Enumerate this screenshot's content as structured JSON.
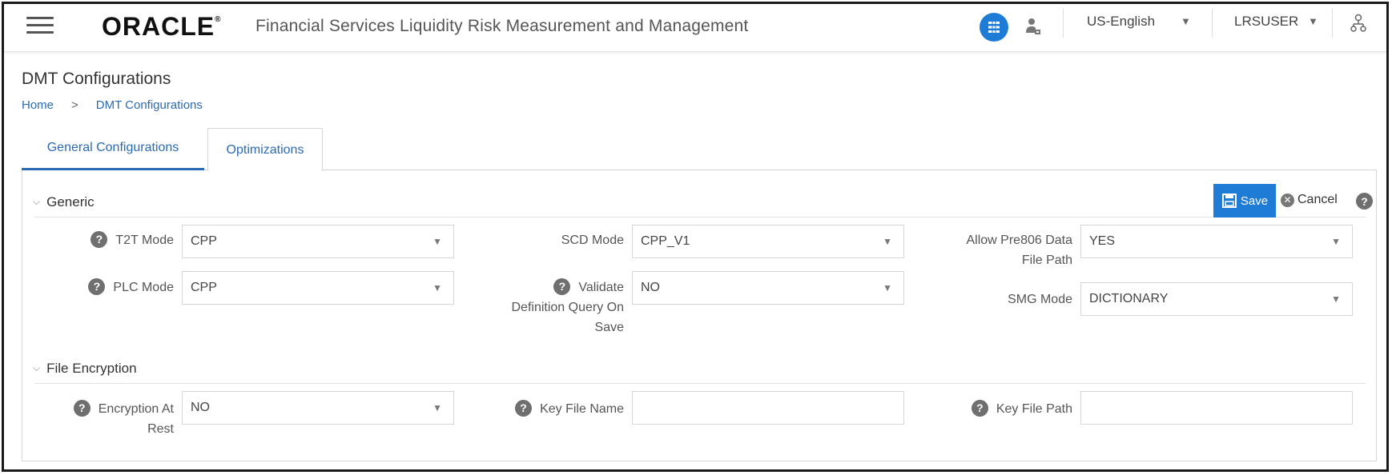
{
  "header": {
    "logo_text": "ORACLE",
    "app_title": "Financial Services Liquidity Risk Measurement and Management",
    "language": "US-English",
    "username": "LRSUSER"
  },
  "page": {
    "title": "DMT Configurations",
    "breadcrumb": {
      "home": "Home",
      "separator": ">",
      "current": "DMT Configurations"
    }
  },
  "tabs": [
    {
      "label": "General Configurations",
      "active": true
    },
    {
      "label": "Optimizations",
      "active": false
    }
  ],
  "actions": {
    "save_label": "Save",
    "cancel_label": "Cancel"
  },
  "sections": {
    "generic": {
      "title": "Generic",
      "fields": {
        "t2t_mode": {
          "label": "T2T Mode",
          "value": "CPP"
        },
        "plc_mode": {
          "label": "PLC Mode",
          "value": "CPP"
        },
        "scd_mode": {
          "label": "SCD Mode",
          "value": "CPP_V1"
        },
        "validate_query": {
          "label_line1": "Validate",
          "label_line2": "Definition Query On",
          "label_line3": "Save",
          "value": "NO"
        },
        "allow_pre806": {
          "label_line1": "Allow Pre806 Data",
          "label_line2": "File Path",
          "value": "YES"
        },
        "smg_mode": {
          "label": "SMG Mode",
          "value": "DICTIONARY"
        }
      }
    },
    "file_encryption": {
      "title": "File Encryption",
      "fields": {
        "encryption_at_rest": {
          "label_line1": "Encryption At",
          "label_line2": "Rest",
          "value": "NO"
        },
        "key_file_name": {
          "label": "Key File Name",
          "value": ""
        },
        "key_file_path": {
          "label": "Key File Path",
          "value": ""
        }
      }
    }
  },
  "colors": {
    "accent": "#1e7bd6",
    "link": "#2a6bb5",
    "help_icon": "#6f6f6f"
  }
}
